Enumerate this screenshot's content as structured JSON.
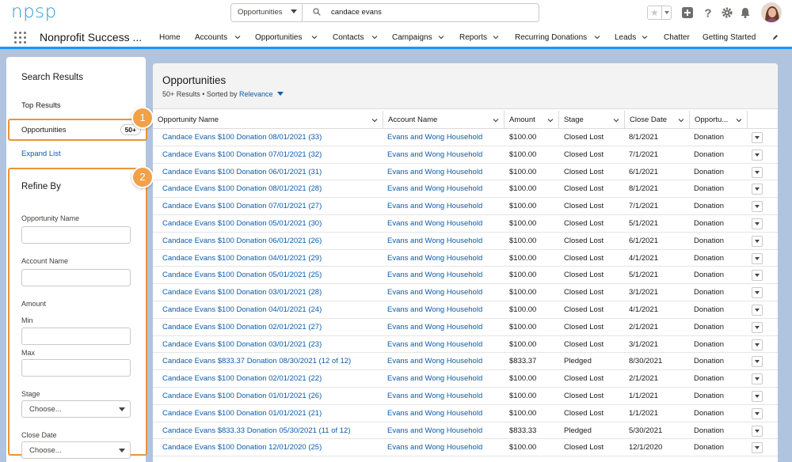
{
  "global_header": {
    "logo": "npsp",
    "search_scope": "Opportunities",
    "search_value": "candace evans"
  },
  "nav": {
    "app_name": "Nonprofit Success ...",
    "items": [
      {
        "label": "Home",
        "has_menu": false
      },
      {
        "label": "Accounts",
        "has_menu": true
      },
      {
        "label": "Opportunities",
        "has_menu": true
      },
      {
        "label": "Contacts",
        "has_menu": true
      },
      {
        "label": "Campaigns",
        "has_menu": true
      },
      {
        "label": "Reports",
        "has_menu": true
      },
      {
        "label": "Recurring Donations",
        "has_menu": true
      },
      {
        "label": "Leads",
        "has_menu": true
      },
      {
        "label": "Chatter",
        "has_menu": false
      },
      {
        "label": "Getting Started",
        "has_menu": false
      }
    ]
  },
  "left_panel": {
    "title": "Search Results",
    "top_results": "Top Results",
    "opportunities_label": "Opportunities",
    "opportunities_count": "50+",
    "expand_list": "Expand List",
    "refine": {
      "title": "Refine By",
      "opportunity_name_label": "Opportunity Name",
      "account_name_label": "Account Name",
      "amount_label": "Amount",
      "min_label": "Min",
      "max_label": "Max",
      "stage_label": "Stage",
      "stage_value": "Choose...",
      "close_date_label": "Close Date",
      "close_date_value": "Choose..."
    }
  },
  "callouts": [
    "1",
    "2"
  ],
  "list": {
    "title": "Opportunities",
    "meta_prefix": "50+ Results • Sorted by",
    "sort_field": "Relevance",
    "columns": [
      "Opportunity Name",
      "Account Name",
      "Amount",
      "Stage",
      "Close Date",
      "Opportu..."
    ],
    "rows": [
      [
        "Candace Evans $100 Donation 08/01/2021 (33)",
        "Evans and Wong Household",
        "$100.00",
        "Closed Lost",
        "8/1/2021",
        "Donation"
      ],
      [
        "Candace Evans $100 Donation 07/01/2021 (32)",
        "Evans and Wong Household",
        "$100.00",
        "Closed Lost",
        "7/1/2021",
        "Donation"
      ],
      [
        "Candace Evans $100 Donation 06/01/2021 (31)",
        "Evans and Wong Household",
        "$100.00",
        "Closed Lost",
        "6/1/2021",
        "Donation"
      ],
      [
        "Candace Evans $100 Donation 08/01/2021 (28)",
        "Evans and Wong Household",
        "$100.00",
        "Closed Lost",
        "8/1/2021",
        "Donation"
      ],
      [
        "Candace Evans $100 Donation 07/01/2021 (27)",
        "Evans and Wong Household",
        "$100.00",
        "Closed Lost",
        "7/1/2021",
        "Donation"
      ],
      [
        "Candace Evans $100 Donation 05/01/2021 (30)",
        "Evans and Wong Household",
        "$100.00",
        "Closed Lost",
        "5/1/2021",
        "Donation"
      ],
      [
        "Candace Evans $100 Donation 06/01/2021 (26)",
        "Evans and Wong Household",
        "$100.00",
        "Closed Lost",
        "6/1/2021",
        "Donation"
      ],
      [
        "Candace Evans $100 Donation 04/01/2021 (29)",
        "Evans and Wong Household",
        "$100.00",
        "Closed Lost",
        "4/1/2021",
        "Donation"
      ],
      [
        "Candace Evans $100 Donation 05/01/2021 (25)",
        "Evans and Wong Household",
        "$100.00",
        "Closed Lost",
        "5/1/2021",
        "Donation"
      ],
      [
        "Candace Evans $100 Donation 03/01/2021 (28)",
        "Evans and Wong Household",
        "$100.00",
        "Closed Lost",
        "3/1/2021",
        "Donation"
      ],
      [
        "Candace Evans $100 Donation 04/01/2021 (24)",
        "Evans and Wong Household",
        "$100.00",
        "Closed Lost",
        "4/1/2021",
        "Donation"
      ],
      [
        "Candace Evans $100 Donation 02/01/2021 (27)",
        "Evans and Wong Household",
        "$100.00",
        "Closed Lost",
        "2/1/2021",
        "Donation"
      ],
      [
        "Candace Evans $100 Donation 03/01/2021 (23)",
        "Evans and Wong Household",
        "$100.00",
        "Closed Lost",
        "3/1/2021",
        "Donation"
      ],
      [
        "Candace Evans $833.37 Donation 08/30/2021 (12 of 12)",
        "Evans and Wong Household",
        "$833.37",
        "Pledged",
        "8/30/2021",
        "Donation"
      ],
      [
        "Candace Evans $100 Donation 02/01/2021 (22)",
        "Evans and Wong Household",
        "$100.00",
        "Closed Lost",
        "2/1/2021",
        "Donation"
      ],
      [
        "Candace Evans $100 Donation 01/01/2021 (26)",
        "Evans and Wong Household",
        "$100.00",
        "Closed Lost",
        "1/1/2021",
        "Donation"
      ],
      [
        "Candace Evans $100 Donation 01/01/2021 (21)",
        "Evans and Wong Household",
        "$100.00",
        "Closed Lost",
        "1/1/2021",
        "Donation"
      ],
      [
        "Candace Evans $833.33 Donation 05/30/2021 (11 of 12)",
        "Evans and Wong Household",
        "$833.33",
        "Pledged",
        "5/30/2021",
        "Donation"
      ],
      [
        "Candace Evans $100 Donation 12/01/2020 (25)",
        "Evans and Wong Household",
        "$100.00",
        "Closed Lost",
        "12/1/2020",
        "Donation"
      ]
    ]
  },
  "colors": {
    "accent_blue": "#0b5cab",
    "brand_bar": "#1b96ff",
    "callout_orange": "#f0a14a",
    "page_bg": "#b0c4df"
  }
}
